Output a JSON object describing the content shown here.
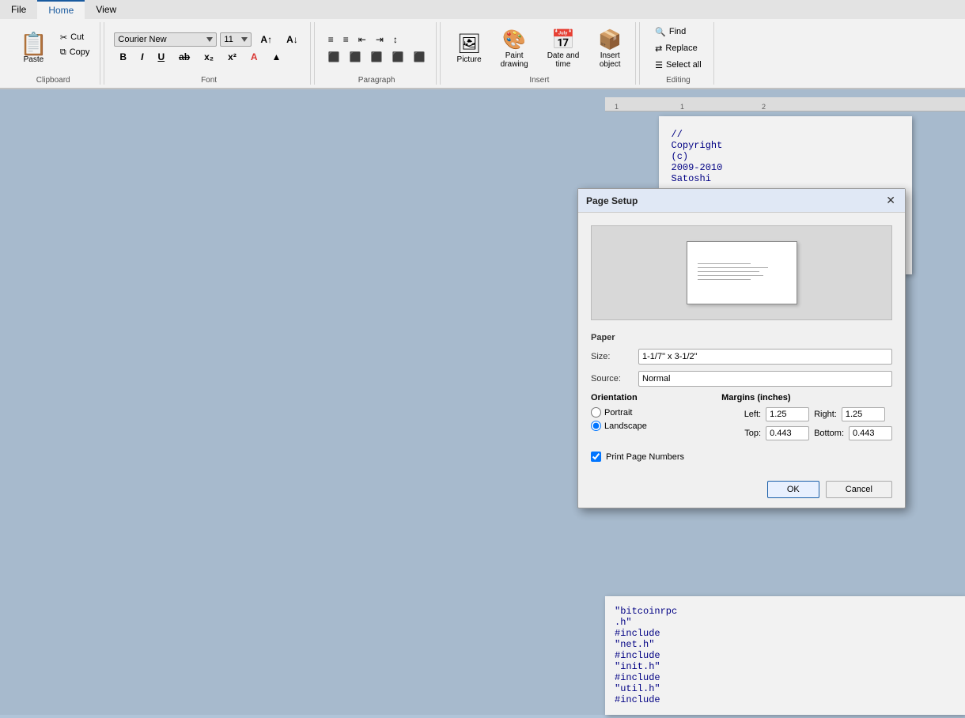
{
  "tabs": {
    "file": "File",
    "home": "Home",
    "view": "View"
  },
  "clipboard": {
    "paste": "Paste",
    "cut": "Cut",
    "copy": "Copy"
  },
  "font": {
    "name": "Courier New",
    "size": "11",
    "bold": "B",
    "italic": "I",
    "underline": "U",
    "strikethrough": "ab",
    "subscript": "x₂",
    "superscript": "x²",
    "font_color": "A",
    "highlight": "▲",
    "group_label": "Font"
  },
  "paragraph": {
    "bullets": "≡",
    "numbering": "≡",
    "indent_less": "←",
    "indent_more": "→",
    "line_spacing": "↕",
    "align_left": "≡",
    "align_center": "≡",
    "align_right": "≡",
    "justify": "≡",
    "group_label": "Paragraph"
  },
  "insert": {
    "picture_label": "Picture",
    "paint_label": "Paint\ndrawing",
    "datetime_label": "Date and\ntime",
    "object_label": "Insert\nobject",
    "group_label": "Insert"
  },
  "editing": {
    "find": "Find",
    "replace": "Replace",
    "select_all": "Select all",
    "group_label": "Editing"
  },
  "document": {
    "line1": "//",
    "line2": "Copyright",
    "line3": "(c)",
    "line4": "2009-2010",
    "line5": "Satoshi"
  },
  "document_bottom": {
    "line1": "\"bitcoinrpc",
    "line2": ".h\"",
    "line3": "#include",
    "line4": "\"net.h\"",
    "line5": "#include",
    "line6": "\"init.h\"",
    "line7": "#include",
    "line8": "\"util.h\"",
    "line9": "#include"
  },
  "dialog": {
    "title": "Page Setup",
    "paper_label": "Paper",
    "size_label": "Size:",
    "size_value": "1-1/7\" x 3-1/2\"",
    "source_label": "Source:",
    "source_value": "Normal",
    "orientation_label": "Orientation",
    "portrait_label": "Portrait",
    "landscape_label": "Landscape",
    "margins_label": "Margins (inches)",
    "left_label": "Left:",
    "left_value": "1.25",
    "right_label": "Right:",
    "right_value": "1.25",
    "top_label": "Top:",
    "top_value": "0.443",
    "bottom_label": "Bottom:",
    "bottom_value": "0.443",
    "print_page_numbers": "Print Page Numbers",
    "ok_label": "OK",
    "cancel_label": "Cancel",
    "close_icon": "✕"
  }
}
